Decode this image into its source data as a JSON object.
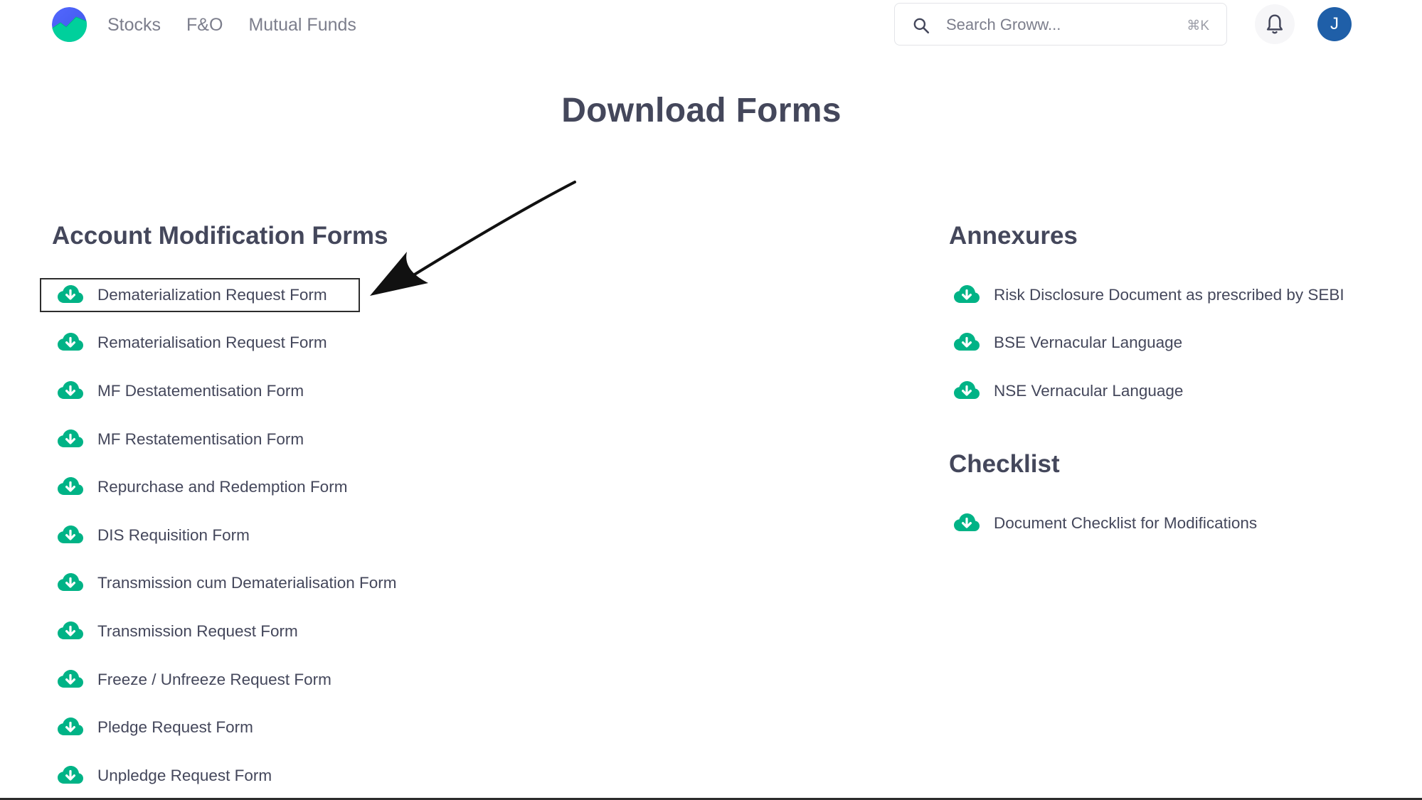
{
  "header": {
    "nav": [
      "Stocks",
      "F&O",
      "Mutual Funds"
    ],
    "search_placeholder": "Search Groww...",
    "search_shortcut": "⌘K",
    "avatar_initial": "J"
  },
  "page_title": "Download Forms",
  "account_forms": {
    "heading": "Account Modification Forms",
    "items": [
      "Dematerialization Request Form",
      "Rematerialisation Request Form",
      "MF Destatementisation Form",
      "MF Restatementisation Form",
      "Repurchase and Redemption Form",
      "DIS Requisition Form",
      "Transmission cum Dematerialisation Form",
      "Transmission Request Form",
      "Freeze / Unfreeze Request Form",
      "Pledge Request Form",
      "Unpledge Request Form"
    ]
  },
  "annexures": {
    "heading": "Annexures",
    "items": [
      "Risk Disclosure Document as prescribed by SEBI",
      "BSE Vernacular Language",
      "NSE Vernacular Language"
    ]
  },
  "checklist": {
    "heading": "Checklist",
    "items": [
      "Document Checklist for Modifications"
    ]
  },
  "colors": {
    "accent_green": "#00b386",
    "text_primary": "#44475b",
    "nav_gray": "#7c7e8c",
    "avatar_blue": "#1f5fa8"
  },
  "icons": {
    "logo": "groww-logo",
    "search": "search-icon",
    "bell": "bell-icon",
    "download": "cloud-download-icon"
  }
}
